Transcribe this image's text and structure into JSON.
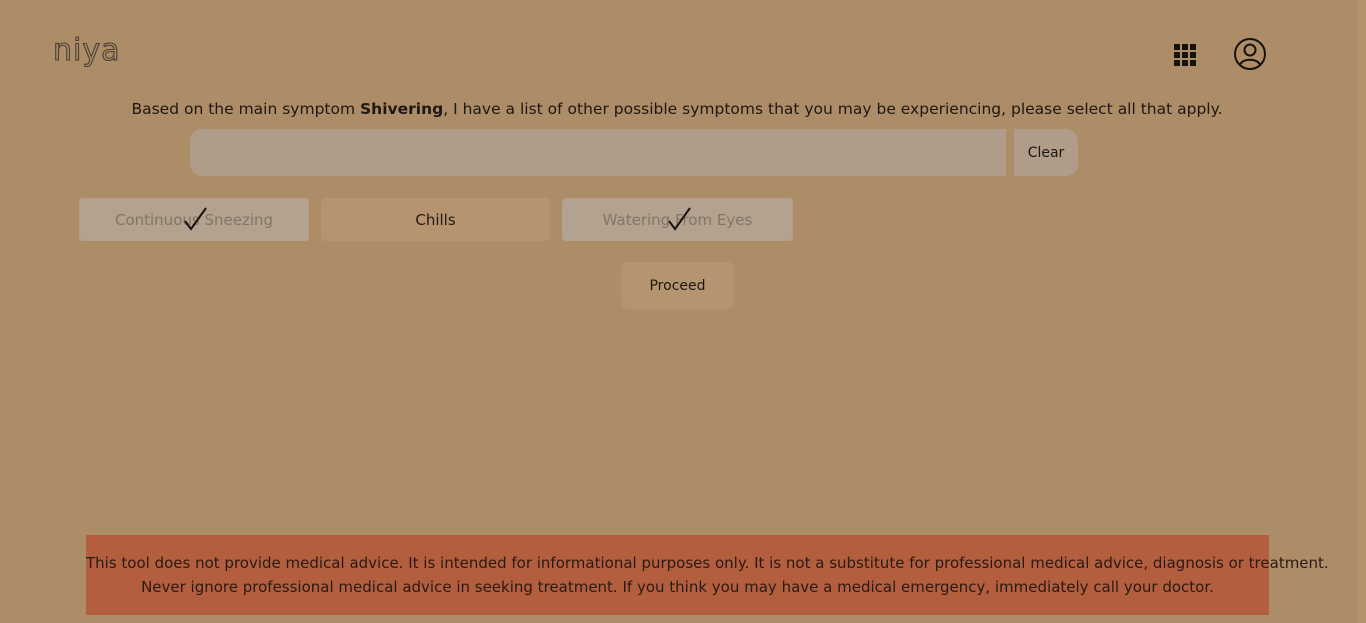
{
  "header": {
    "logo_text": "niya",
    "apps_icon": "apps-grid-icon",
    "account_icon": "account-circle-icon"
  },
  "prompt": {
    "before": "Based on the main symptom ",
    "symptom": "Shivering",
    "after": ", I have a list of other possible symptoms that you may be experiencing, please select all that apply."
  },
  "search": {
    "value": "",
    "placeholder": "",
    "clear_label": "Clear"
  },
  "symptoms": [
    {
      "label": "Continuous Sneezing",
      "selected": true
    },
    {
      "label": "Chills",
      "selected": false
    },
    {
      "label": "Watering From Eyes",
      "selected": true
    }
  ],
  "proceed_label": "Proceed",
  "disclaimer": {
    "line1": "This tool does not provide medical advice. It is intended for informational purposes only. It is not a substitute for professional medical advice, diagnosis or treatment.",
    "line2": "Never ignore professional medical advice in seeking treatment. If you think you may have a medical emergency, immediately call your doctor."
  },
  "colors": {
    "background": "#ad8d68",
    "chip_selected": "#b2a28f",
    "chip_unselected": "#b5946f",
    "disclaimer": "#b25e3f"
  }
}
